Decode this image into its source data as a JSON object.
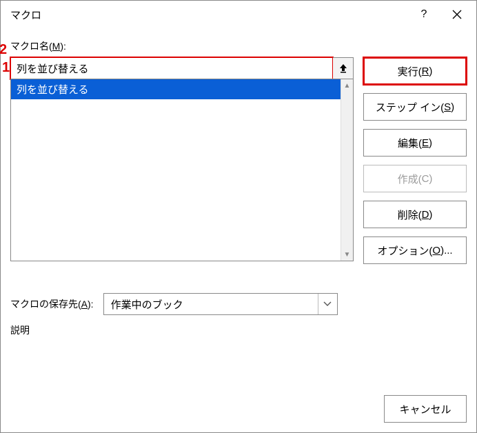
{
  "titlebar": {
    "title": "マクロ",
    "help": "?",
    "close": "×"
  },
  "labels": {
    "macro_name_prefix": "マクロ名(",
    "macro_name_key": "M",
    "macro_name_suffix": "):",
    "save_in_prefix": "マクロの保存先(",
    "save_in_key": "A",
    "save_in_suffix": "):",
    "description": "説明"
  },
  "name_input": {
    "value": "列を並び替える"
  },
  "list": {
    "items": [
      "列を並び替える"
    ],
    "selected_index": 0
  },
  "save_in": {
    "value": "作業中のブック"
  },
  "buttons": {
    "run_prefix": "実行(",
    "run_key": "R",
    "run_suffix": ")",
    "step_prefix": "ステップ イン(",
    "step_key": "S",
    "step_suffix": ")",
    "edit_prefix": "編集(",
    "edit_key": "E",
    "edit_suffix": ")",
    "create_prefix": "作成(",
    "create_key": "C",
    "create_suffix": ")",
    "delete_prefix": "削除(",
    "delete_key": "D",
    "delete_suffix": ")",
    "options_prefix": "オプション(",
    "options_key": "O",
    "options_suffix": ")...",
    "cancel": "キャンセル"
  },
  "annotations": {
    "one": "1",
    "two": "2"
  }
}
